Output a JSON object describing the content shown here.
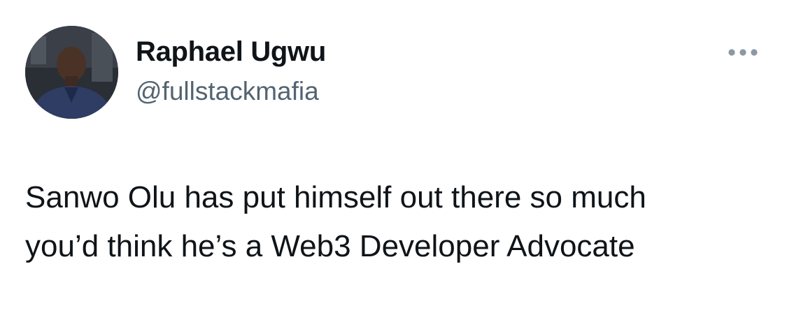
{
  "author": {
    "display_name": "Raphael Ugwu",
    "handle": "@fullstackmafia",
    "avatar_icon": "profile-photo"
  },
  "menu": {
    "more_icon": "more-horizontal-icon"
  },
  "tweet": {
    "lines": [
      "Sanwo Olu has put himself out there so much",
      "you’d think he’s a Web3 Developer Advocate"
    ]
  },
  "colors": {
    "text_primary": "#0f1419",
    "text_secondary": "#536471",
    "more_icon": "#8b98a5",
    "background": "#ffffff"
  }
}
